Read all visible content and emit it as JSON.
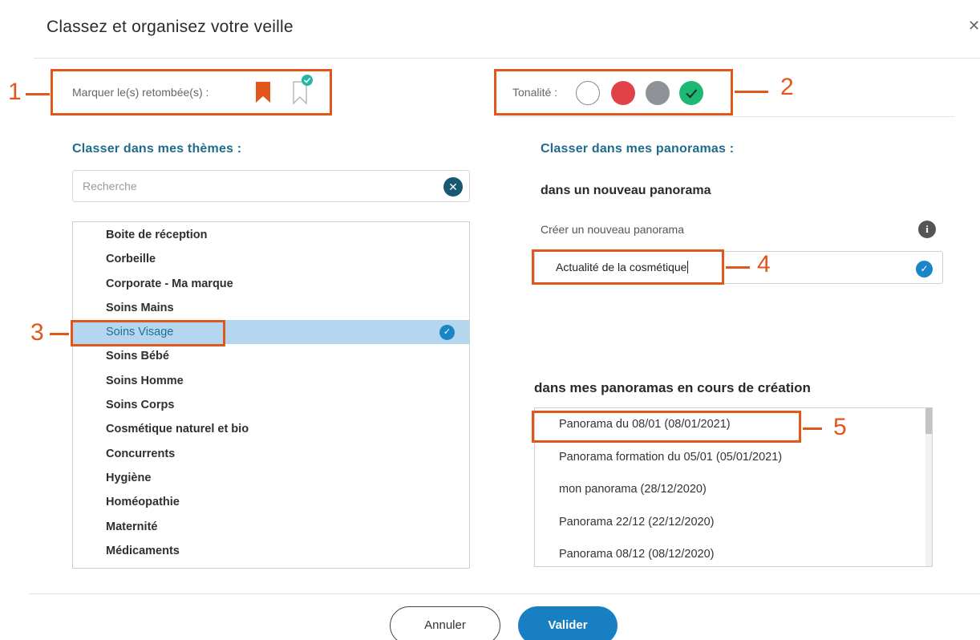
{
  "modal": {
    "title": "Classez et organisez votre veille",
    "close_icon": "close-icon"
  },
  "marker": {
    "label": "Marquer le(s) retombée(s) :",
    "icons": [
      "bookmark-filled-icon",
      "bookmark-checked-icon"
    ]
  },
  "tonality": {
    "label": "Tonalité :",
    "options": [
      {
        "name": "neutre",
        "color": "#ffffff"
      },
      {
        "name": "negative",
        "color": "#e04246"
      },
      {
        "name": "neutral-grey",
        "color": "#8e9196"
      },
      {
        "name": "positive",
        "color": "#1db873"
      }
    ]
  },
  "themes": {
    "section_title": "Classer dans mes thèmes :",
    "search_placeholder": "Recherche",
    "items": [
      {
        "label": "Boite de réception",
        "selected": false
      },
      {
        "label": "Corbeille",
        "selected": false
      },
      {
        "label": "Corporate - Ma marque",
        "selected": false
      },
      {
        "label": "Soins Mains",
        "selected": false
      },
      {
        "label": "Soins Visage",
        "selected": true
      },
      {
        "label": "Soins Bébé",
        "selected": false
      },
      {
        "label": "Soins Homme",
        "selected": false
      },
      {
        "label": "Soins Corps",
        "selected": false
      },
      {
        "label": "Cosmétique naturel et bio",
        "selected": false
      },
      {
        "label": "Concurrents",
        "selected": false
      },
      {
        "label": "Hygiène",
        "selected": false
      },
      {
        "label": "Homéopathie",
        "selected": false
      },
      {
        "label": "Maternité",
        "selected": false
      },
      {
        "label": "Médicaments",
        "selected": false
      }
    ]
  },
  "panoramas": {
    "section_title": "Classer dans mes panoramas :",
    "new_title": "dans un nouveau panorama",
    "create_label": "Créer un nouveau panorama",
    "new_value": "Actualité de la cosmétique",
    "in_progress_title": "dans mes panoramas en cours de création",
    "items": [
      "Panorama du 08/01 (08/01/2021)",
      "Panorama formation du 05/01 (05/01/2021)",
      "mon panorama (28/12/2020)",
      "Panorama 22/12 (22/12/2020)",
      "Panorama 08/12 (08/12/2020)"
    ]
  },
  "buttons": {
    "cancel": "Annuler",
    "validate": "Valider"
  },
  "callouts": {
    "n1": "1",
    "n2": "2",
    "n3": "3",
    "n4": "4",
    "n5": "5",
    "color": "#e0561b"
  }
}
